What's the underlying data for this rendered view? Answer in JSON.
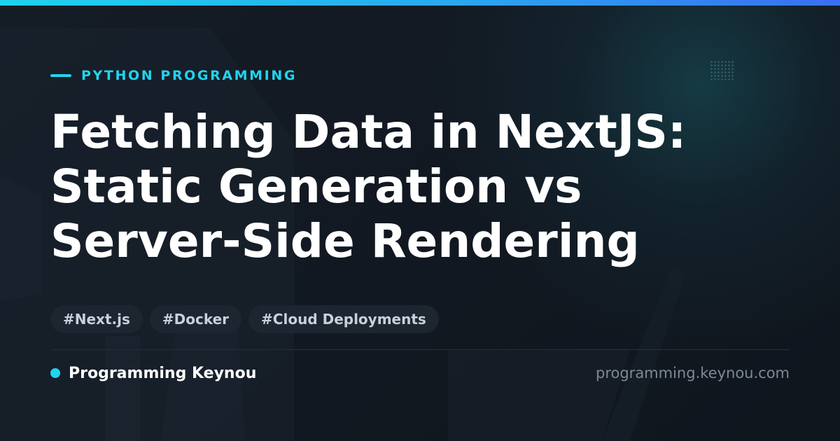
{
  "theme": {
    "accent": "#22d3ee",
    "background": "#121821",
    "title_color": "#ffffff",
    "tag_background": "#1c2530",
    "muted_text": "#7e8896"
  },
  "header": {
    "category": "PYTHON PROGRAMMING"
  },
  "article": {
    "title_lines": [
      "Fetching Data in NextJS:",
      "Static Generation vs",
      "Server-Side Rendering"
    ],
    "tags": [
      "#Next.js",
      "#Docker",
      "#Cloud Deployments"
    ]
  },
  "footer": {
    "brand_name": "Programming Keynou",
    "brand_icon": "dot-icon",
    "site_url": "programming.keynou.com"
  }
}
